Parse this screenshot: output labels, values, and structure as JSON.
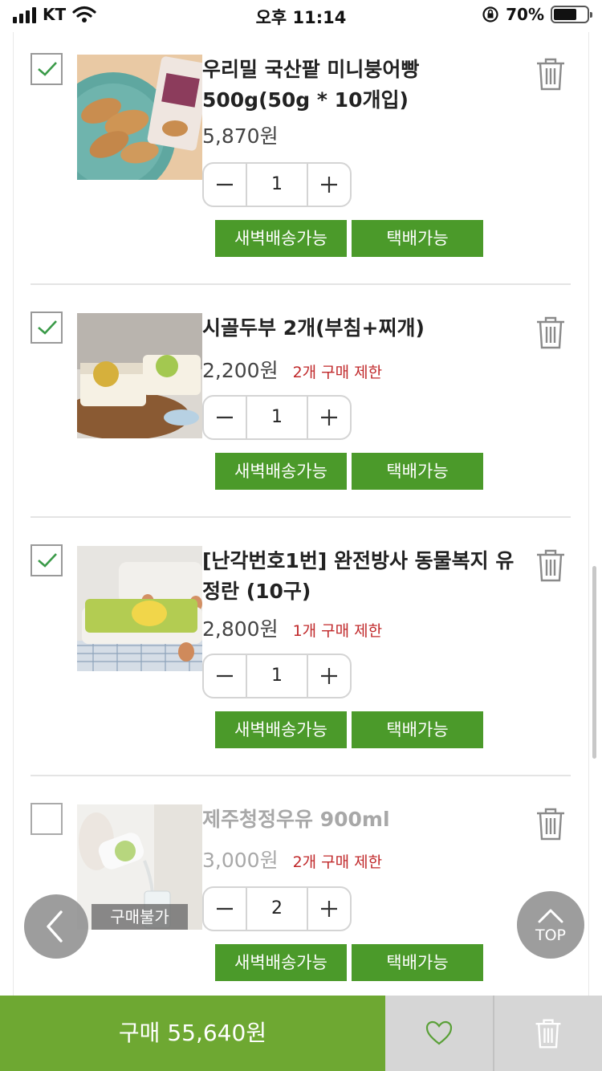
{
  "status_bar": {
    "carrier": "KT",
    "time": "오후 11:14",
    "battery": "70%",
    "battery_level": 0.7
  },
  "items": [
    {
      "name": "우리밀 국산팥 미니붕어빵 500g(50g * 10개입)",
      "price": "5,870원",
      "limit": "",
      "quantity": "1",
      "checked": true,
      "available": true,
      "badges": [
        "새벽배송가능",
        "택배가능"
      ]
    },
    {
      "name": "시골두부 2개(부침+찌개)",
      "price": "2,200원",
      "limit": "2개 구매 제한",
      "quantity": "1",
      "checked": true,
      "available": true,
      "badges": [
        "새벽배송가능",
        "택배가능"
      ]
    },
    {
      "name": "[난각번호1번] 완전방사 동물복지 유정란 (10구)",
      "price": "2,800원",
      "limit": "1개 구매 제한",
      "quantity": "1",
      "checked": true,
      "available": true,
      "badges": [
        "새벽배송가능",
        "택배가능"
      ]
    },
    {
      "name": "제주청정우유 900ml",
      "price": "3,000원",
      "limit": "2개 구매 제한",
      "quantity": "2",
      "checked": false,
      "available": false,
      "unavailable_label": "구매불가",
      "badges": [
        "새벽배송가능",
        "택배가능"
      ]
    }
  ],
  "floating": {
    "top_label": "TOP"
  },
  "bottom_bar": {
    "buy_label": "구매 55,640원"
  },
  "colors": {
    "accent_green": "#4b9a2a",
    "buy_green": "#6ea832",
    "limit_red": "#c0282a"
  },
  "icons": [
    "trash-icon",
    "minus-icon",
    "plus-icon",
    "check-icon",
    "chevron-left-icon",
    "chevron-up-icon",
    "heart-icon",
    "wifi-icon",
    "signal-icon",
    "battery-icon",
    "rotation-lock-icon"
  ]
}
